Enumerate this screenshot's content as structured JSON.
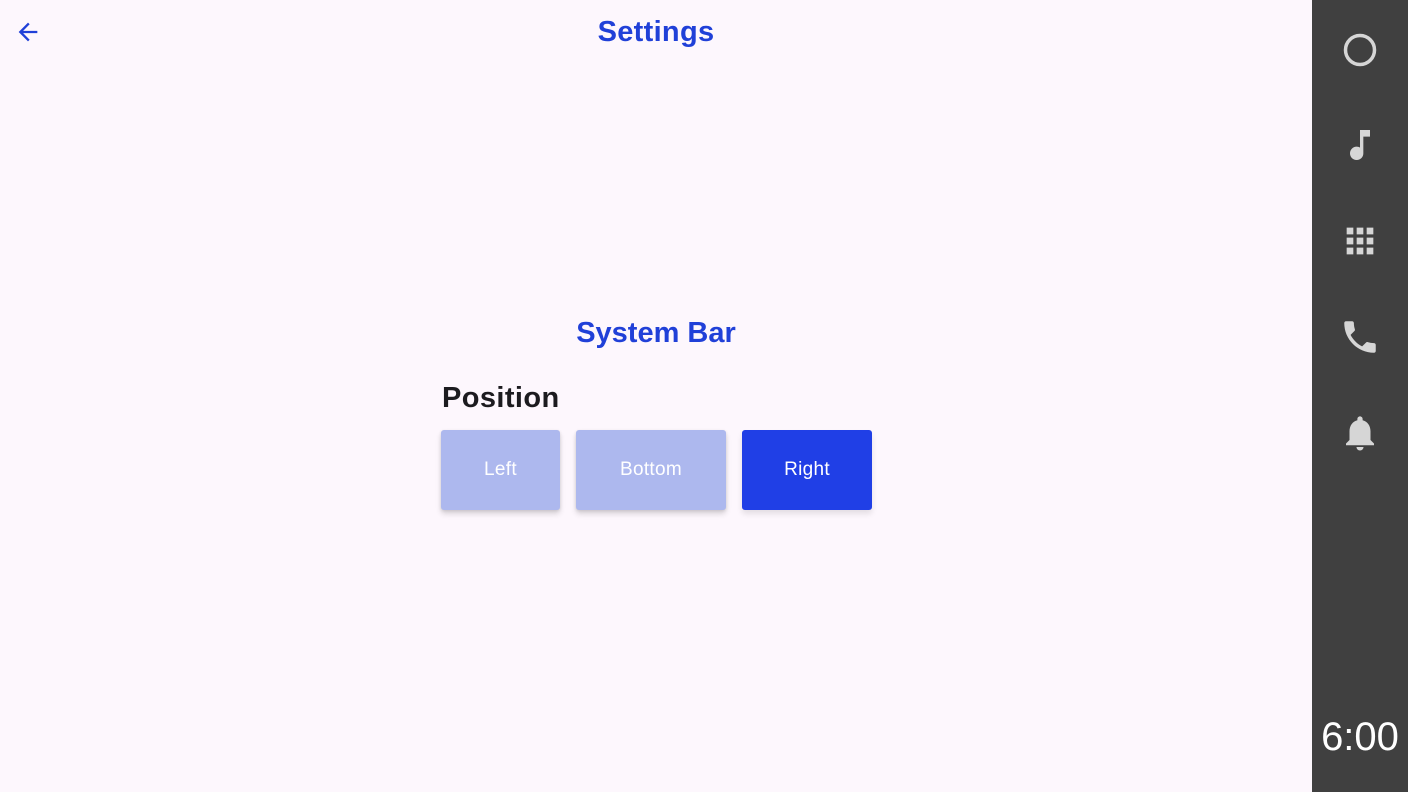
{
  "header": {
    "title": "Settings",
    "back_icon": "arrow-left-icon"
  },
  "main": {
    "section_title": "System Bar",
    "position_label": "Position",
    "position_options": [
      {
        "label": "Left",
        "selected": false
      },
      {
        "label": "Bottom",
        "selected": false
      },
      {
        "label": "Right",
        "selected": true
      }
    ]
  },
  "system_bar": {
    "icons": [
      "home-circle-icon",
      "music-note-icon",
      "apps-grid-icon",
      "phone-icon",
      "notification-bell-icon"
    ],
    "clock": "6:00"
  },
  "colors": {
    "accent": "#2040d8",
    "selected_button": "#203fe6",
    "unselected_button": "#adb8ee",
    "background": "#fdf7fd",
    "system_bar": "#404040",
    "system_icon": "#d6d6d6"
  }
}
